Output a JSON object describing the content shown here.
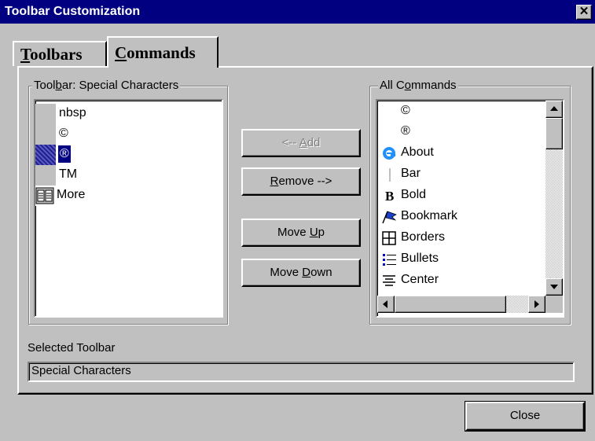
{
  "window": {
    "title": "Toolbar Customization",
    "close_glyph": "✕"
  },
  "tabs": [
    {
      "label_pre": "",
      "label_u": "T",
      "label_post": "oolbars"
    },
    {
      "label_pre": "",
      "label_u": "C",
      "label_post": "ommands"
    }
  ],
  "toolbar_group": {
    "label_pre": "Tool",
    "label_u": "b",
    "label_post": "ar: Special Characters",
    "items": [
      "nbsp",
      "©",
      "®",
      "TM",
      "More"
    ],
    "selected_index": 2
  },
  "buttons": {
    "add": {
      "pre": "<-- ",
      "u": "A",
      "post": "dd",
      "disabled": true
    },
    "remove": {
      "pre": "",
      "u": "R",
      "post": "emove -->"
    },
    "move_up": {
      "pre": "Move ",
      "u": "U",
      "post": "p"
    },
    "move_down": {
      "pre": "Move ",
      "u": "D",
      "post": "own"
    }
  },
  "commands_group": {
    "label_pre": "All C",
    "label_u": "o",
    "label_post": "mmands",
    "items": [
      {
        "label": "©",
        "icon": "none"
      },
      {
        "label": "®",
        "icon": "none"
      },
      {
        "label": "About",
        "icon": "ie-logo-icon"
      },
      {
        "label": "Bar",
        "icon": "bar-icon"
      },
      {
        "label": "Bold",
        "icon": "bold-icon"
      },
      {
        "label": "Bookmark",
        "icon": "bookmark-flag-icon"
      },
      {
        "label": "Borders",
        "icon": "borders-grid-icon"
      },
      {
        "label": "Bullets",
        "icon": "bullets-list-icon"
      },
      {
        "label": "Center",
        "icon": "center-align-icon"
      }
    ]
  },
  "selected_toolbar": {
    "label": "Selected Toolbar",
    "value": "Special Characters"
  },
  "close_button": {
    "label": "Close"
  },
  "colors": {
    "title_bar": "#000080",
    "face": "#c0c0c0",
    "selection": "#000080"
  }
}
